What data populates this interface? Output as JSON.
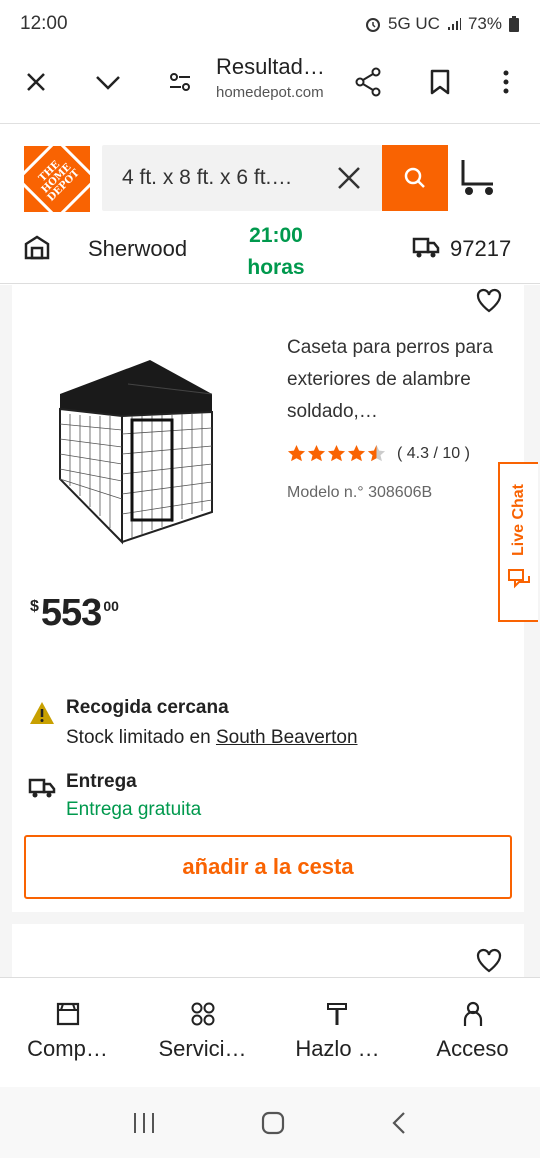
{
  "status": {
    "time": "12:00",
    "network": "5G UC",
    "battery": "73%"
  },
  "browser": {
    "page_title": "Resultad…",
    "domain": "homedepot.com"
  },
  "header": {
    "logo_text": "THE HOME DEPOT",
    "search_query": "4 ft. x 8 ft. x 6 ft.…",
    "store_name": "Sherwood",
    "store_hours_time": "21:00",
    "store_hours_label": "horas",
    "zip_code": "97217"
  },
  "product": {
    "title": "Caseta para perros para exteriores de alambre soldado,…",
    "rating": 4.3,
    "rating_text": "( 4.3 /  10 )",
    "model": "Modelo n.° 308606B",
    "price_currency": "$",
    "price_int": "553",
    "price_dec": "00",
    "pickup_title": "Recogida cercana",
    "pickup_prefix": "Stock limitado en ",
    "pickup_store": "South Beaverton",
    "delivery_title": "Entrega",
    "delivery_sub": "Entrega gratuita",
    "add_to_cart": "añadir a la cesta"
  },
  "live_chat": "Live Chat",
  "bottom_nav": {
    "items": [
      {
        "label": "Comp…",
        "icon": "store-front-icon"
      },
      {
        "label": "Servici…",
        "icon": "services-icon"
      },
      {
        "label": "Hazlo …",
        "icon": "hammer-icon"
      },
      {
        "label": "Acceso",
        "icon": "person-icon"
      }
    ]
  },
  "colors": {
    "brand_orange": "#f96302",
    "green": "#00994d",
    "warning": "#c8a000"
  }
}
